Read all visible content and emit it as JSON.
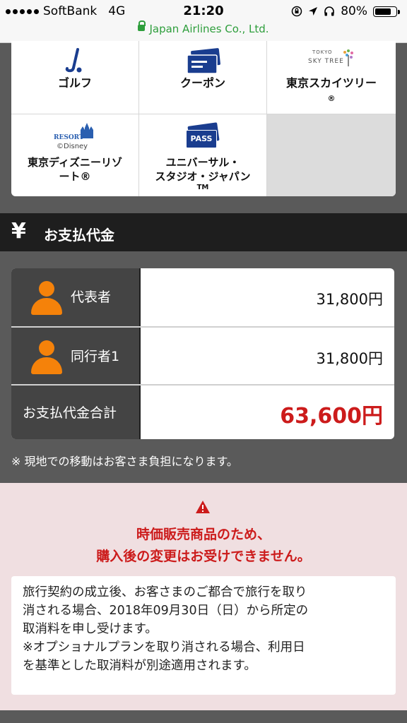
{
  "status_bar": {
    "carrier": "SoftBank",
    "network": "4G",
    "time": "21:20",
    "battery": "80%",
    "battery_level": 0.8,
    "url": "Japan Airlines Co., Ltd.",
    "icons": [
      "signal-icon",
      "rotation-lock-icon",
      "location-icon",
      "headphones-icon",
      "battery-icon",
      "lock-icon"
    ]
  },
  "categories": [
    {
      "label": "ゴルフ",
      "icon": "golf-icon"
    },
    {
      "label": "クーポン",
      "icon": "coupon-icon"
    },
    {
      "label": "東京スカイツリー",
      "label2": "®",
      "logo_text": "TOKYO",
      "logo_text2": "SKY TREE",
      "icon": "skytree-logo"
    },
    {
      "label": "東京ディズニーリゾ",
      "label2": "ート®",
      "logo_text": "RESORT",
      "logo_text2": "©Disney",
      "icon": "disney-resort-logo"
    },
    {
      "label": "ユニバーサル・",
      "label2": "スタジオ・ジャパン",
      "label3": "TM",
      "logo_text": "PASS",
      "icon": "pass-icon"
    }
  ],
  "payment": {
    "yen_symbol": "¥",
    "title": "お支払代金",
    "rows": [
      {
        "label": "代表者",
        "value": "31,800円"
      },
      {
        "label": "同行者1",
        "value": "31,800円"
      }
    ],
    "total_label": "お支払代金合計",
    "total_value": "63,600円",
    "note": "※ 現地での移動はお客さま負担になります。"
  },
  "warning": {
    "line1": "時価販売商品のため、",
    "line2": "購入後の変更はお受けできません。",
    "body1": "旅行契約の成立後、お客さまのご都合で旅行を取り",
    "body2": "消される場合、2018年09月30日（日）から所定の",
    "body3": "取消料を申し受けます。",
    "body4": "※オプショナルプランを取り消される場合、利用日",
    "body5": "を基準とした取消料が別途適用されます。"
  },
  "colors": {
    "accent_orange": "#f5820a",
    "price_red": "#cc1b1b",
    "header_dark": "#1e1e1e",
    "url_green": "#2e9e3c",
    "brand_blue": "#1a3d8f"
  }
}
